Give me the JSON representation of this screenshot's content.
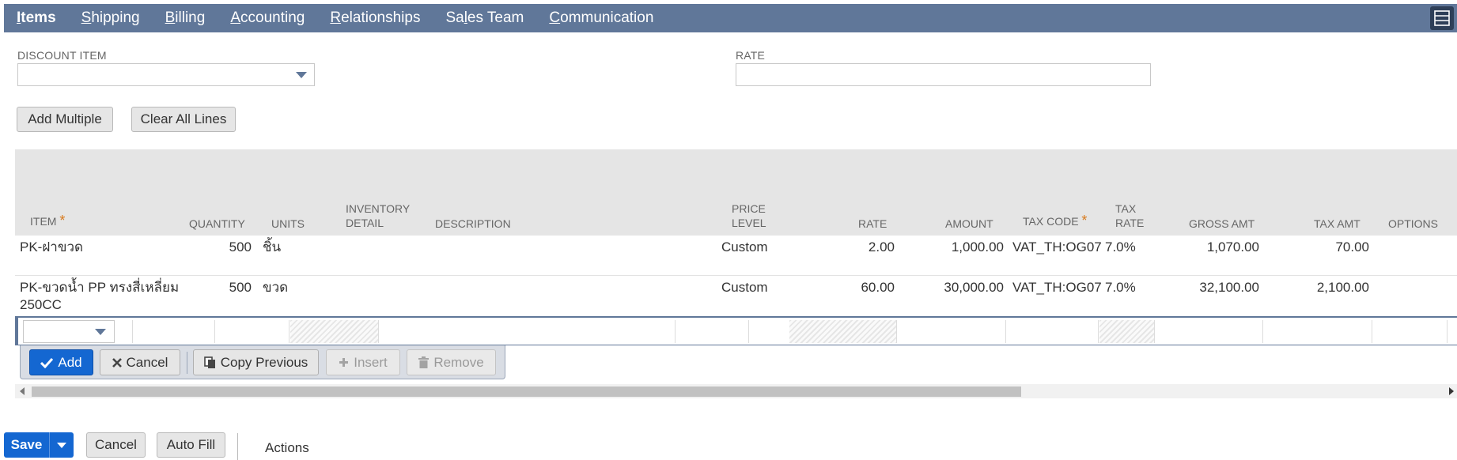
{
  "tabs": [
    {
      "k": "I",
      "rest": "tems",
      "active": true
    },
    {
      "k": "S",
      "rest": "hipping",
      "active": false
    },
    {
      "k": "B",
      "rest": "illing",
      "active": false
    },
    {
      "k": "A",
      "rest": "ccounting",
      "active": false
    },
    {
      "k": "R",
      "rest": "elationships",
      "active": false
    },
    {
      "pre": "Sa",
      "k": "l",
      "rest": "es Team",
      "active": false
    },
    {
      "k": "C",
      "rest": "ommunication",
      "active": false
    }
  ],
  "fields": {
    "discount_item_label": "DISCOUNT ITEM",
    "discount_item_value": "",
    "rate_label": "RATE",
    "rate_value": ""
  },
  "buttons": {
    "add_multiple": "Add Multiple",
    "clear_all_lines": "Clear All Lines"
  },
  "columns": {
    "item": "ITEM",
    "quantity": "QUANTITY",
    "units": "UNITS",
    "inventory_detail_1": "INVENTORY",
    "inventory_detail_2": "DETAIL",
    "description": "DESCRIPTION",
    "price_level_1": "PRICE",
    "price_level_2": "LEVEL",
    "rate": "RATE",
    "amount": "AMOUNT",
    "tax_code": "TAX CODE",
    "tax_rate_1": "TAX",
    "tax_rate_2": "RATE",
    "gross_amt": "GROSS AMT",
    "tax_amt": "TAX AMT",
    "options": "OPTIONS",
    "required_mark": "*"
  },
  "rows": [
    {
      "item": "PK-ฝาขวด",
      "item2": "",
      "quantity": "500",
      "units": "ชิ้น",
      "price_level": "Custom",
      "rate": "2.00",
      "amount": "1,000.00",
      "tax_code": "VAT_TH:OG07",
      "tax_rate": "7.0%",
      "gross_amt": "1,070.00",
      "tax_amt": "70.00"
    },
    {
      "item": "PK-ขวดน้ำ PP ทรงสี่เหลี่ยม",
      "item2": "250CC",
      "quantity": "500",
      "units": "ขวด",
      "price_level": "Custom",
      "rate": "60.00",
      "amount": "30,000.00",
      "tax_code": "VAT_TH:OG07",
      "tax_rate": "7.0%",
      "gross_amt": "32,100.00",
      "tax_amt": "2,100.00"
    }
  ],
  "line_actions": {
    "add": "Add",
    "cancel": "Cancel",
    "copy_previous": "Copy Previous",
    "insert": "Insert",
    "remove": "Remove"
  },
  "footer": {
    "save": "Save",
    "cancel": "Cancel",
    "auto_fill": "Auto Fill",
    "actions": "Actions"
  },
  "colors": {
    "tabbar": "#607799",
    "primary": "#1467d1",
    "required": "#d87a1c"
  }
}
